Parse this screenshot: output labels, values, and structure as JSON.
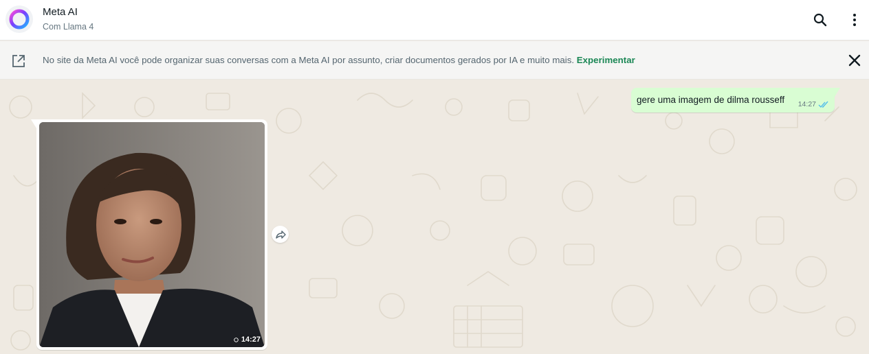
{
  "header": {
    "title": "Meta AI",
    "subtitle": "Com Llama 4",
    "avatar_icon": "meta-ai-ring-icon",
    "search_icon": "search-icon",
    "menu_icon": "kebab-menu-icon"
  },
  "banner": {
    "icon": "external-link-icon",
    "text": "No site da Meta AI você pode organizar suas conversas com a Meta AI por assunto, criar documentos gerados por IA e muito mais. ",
    "link": "Experimentar",
    "close_icon": "close-icon"
  },
  "messages": [
    {
      "direction": "outgoing",
      "type": "text",
      "text": "gere uma imagem de dilma rousseff",
      "time": "14:27",
      "status_icon": "double-check-read-icon"
    },
    {
      "direction": "incoming",
      "type": "image",
      "time": "14:27",
      "forward_icon": "forward-icon"
    }
  ],
  "colors": {
    "chat_bg": "#efeae2",
    "outgoing_bubble": "#d9fdd3",
    "link_green": "#1b8755",
    "read_tick": "#53bdeb"
  }
}
